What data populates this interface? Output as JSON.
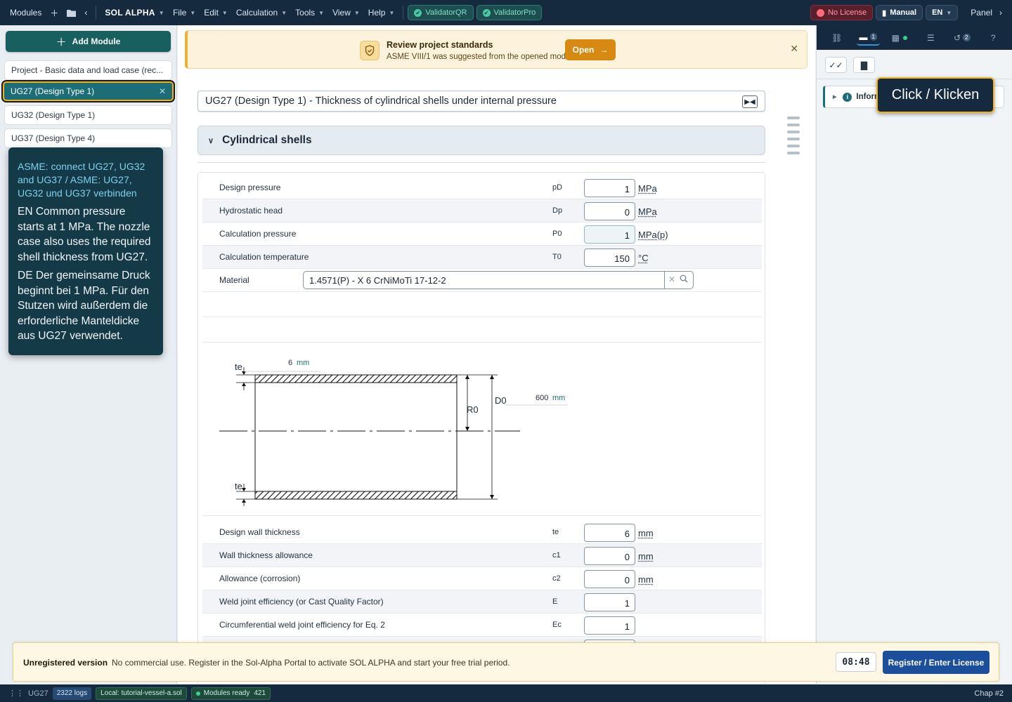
{
  "menubar": {
    "modules": "Modules",
    "brand": "SOL ALPHA",
    "menus": [
      "File",
      "Edit",
      "Calculation",
      "Tools",
      "View",
      "Help"
    ],
    "validators": [
      "ValidatorQR",
      "ValidatorPro"
    ],
    "license": "No License",
    "manual": "Manual",
    "lang": "EN",
    "panel": "Panel"
  },
  "sidebar": {
    "add_label": "Add Module",
    "items": [
      {
        "label": "Project - Basic data and load case (rec..."
      },
      {
        "label": "UG27 (Design Type 1)",
        "active": true
      },
      {
        "label": "UG32 (Design Type 1)"
      },
      {
        "label": "UG37 (Design Type 4)"
      }
    ],
    "tooltip": {
      "title": "ASME: connect UG27, UG32 and UG37 / ASME: UG27, UG32 und UG37 verbinden",
      "en": "EN Common pressure starts at 1 MPa. The nozzle case also uses the required shell thickness from UG27.",
      "de": "DE Der gemeinsame Druck beginnt bei 1 MPa. Für den Stutzen wird außerdem die erforderliche Manteldicke aus UG27 verwendet."
    }
  },
  "banner": {
    "title": "Review project standards",
    "subtitle": "ASME VIII/1 was suggested from the opened module.",
    "open_label": "Open"
  },
  "module": {
    "title": "UG27 (Design Type 1) - Thickness of cylindrical shells under internal pressure",
    "section": "Cylindrical shells"
  },
  "params_top": [
    {
      "label": "Design pressure",
      "sym": "pD",
      "value": "1",
      "unit": "MPa"
    },
    {
      "label": "Hydrostatic head",
      "sym": "Dp",
      "value": "0",
      "unit": "MPa"
    },
    {
      "label": "Calculation pressure",
      "sym": "P0",
      "value": "1",
      "unit": "MPa(p)",
      "calc": true
    },
    {
      "label": "Calculation temperature",
      "sym": "T0",
      "value": "150",
      "unit": "°C"
    }
  ],
  "material": {
    "label": "Material",
    "value": "1.4571(P) - X 6 CrNiMoTi 17-12-2"
  },
  "drawing": {
    "te_label": "te",
    "te_value": "6",
    "unit": "mm",
    "r_label": "R0",
    "d_label": "D0",
    "d_value": "600"
  },
  "params_bottom": [
    {
      "label": "Design wall thickness",
      "sym": "te",
      "value": "6",
      "unit": "mm"
    },
    {
      "label": "Wall thickness allowance",
      "sym": "c1",
      "value": "0",
      "unit": "mm"
    },
    {
      "label": "Allowance (corrosion)",
      "sym": "c2",
      "value": "0",
      "unit": "mm"
    },
    {
      "label": "Weld joint efficiency (or Cast Quality Factor)",
      "sym": "E",
      "value": "1",
      "unit": ""
    },
    {
      "label": "Circumferential weld joint efficiency for Eq. 2",
      "sym": "Ec",
      "value": "1",
      "unit": ""
    }
  ],
  "right_panel": {
    "tab_badges": [
      "1",
      "2"
    ],
    "info_label": "Inform",
    "click_hint": "Click / Klicken"
  },
  "license_bar": {
    "title": "Unregistered version",
    "message": "No commercial use. Register in the Sol-Alpha Portal to activate SOL ALPHA and start your free trial period.",
    "timer": "08:48",
    "register_label": "Register / Enter License"
  },
  "statusbar": {
    "module": "UG27",
    "logs": "2322 logs",
    "file": "Local: tutorial-vessel-a.sol",
    "ready": "Modules ready",
    "ready_count": "421",
    "chap": "Chap #2"
  },
  "colors": {
    "topbar": "#152a3f",
    "accent_teal": "#1d6d77",
    "highlight": "#f3b11b",
    "register_blue": "#1b4f9c"
  }
}
